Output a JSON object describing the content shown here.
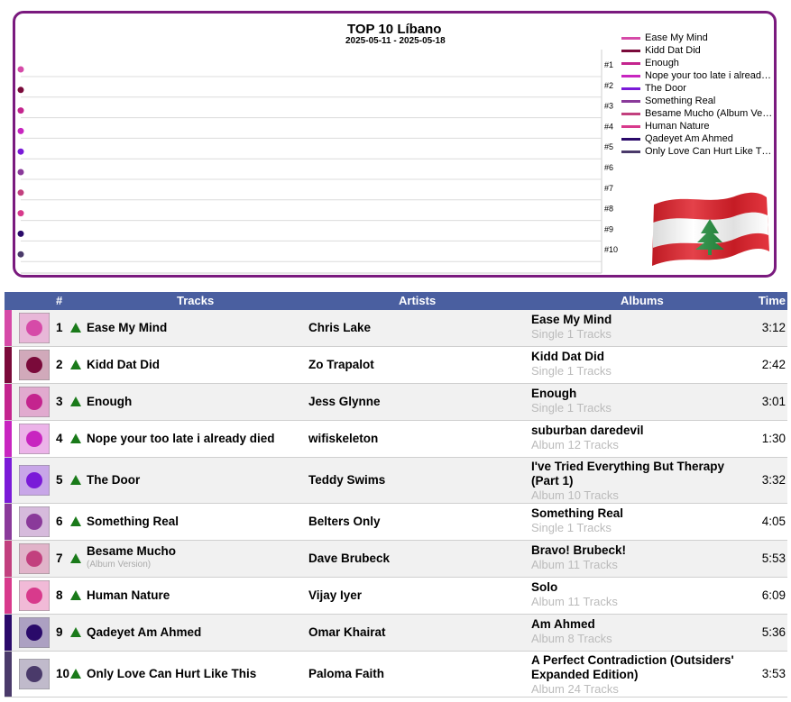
{
  "chart": {
    "title": "TOP 10 Líbano",
    "subtitle": "2025-05-11 - 2025-05-18",
    "rank_labels": [
      "#1",
      "#2",
      "#3",
      "#4",
      "#5",
      "#6",
      "#7",
      "#8",
      "#9",
      "#10"
    ],
    "flag_icon": "lebanon-flag-icon"
  },
  "chart_data": {
    "type": "line",
    "title": "TOP 10 Líbano",
    "subtitle": "2025-05-11 - 2025-05-18",
    "y_axis": "rank",
    "ylim": [
      1,
      10
    ],
    "series": [
      {
        "name": "Ease My Mind",
        "rank": 1,
        "color": "#d64aa8"
      },
      {
        "name": "Kidd Dat Did",
        "rank": 2,
        "color": "#7a0a3a"
      },
      {
        "name": "Enough",
        "rank": 3,
        "color": "#c4248e"
      },
      {
        "name": "Nope your too late i alread…",
        "rank": 4,
        "color": "#c825c0"
      },
      {
        "name": "The Door",
        "rank": 5,
        "color": "#7a1ad8"
      },
      {
        "name": "Something Real",
        "rank": 6,
        "color": "#8a3a9a"
      },
      {
        "name": "Besame Mucho (Album Ve…",
        "rank": 7,
        "color": "#c2407e"
      },
      {
        "name": "Human Nature",
        "rank": 8,
        "color": "#d83a8c"
      },
      {
        "name": "Qadeyet Am Ahmed",
        "rank": 9,
        "color": "#2a0a6a"
      },
      {
        "name": "Only Love Can Hurt Like T…",
        "rank": 10,
        "color": "#4a3a6a"
      }
    ]
  },
  "table": {
    "headers": {
      "num": "#",
      "tracks": "Tracks",
      "artists": "Artists",
      "albums": "Albums",
      "time": "Time"
    },
    "rows": [
      {
        "rank": "1",
        "track": "Ease My Mind",
        "track_sub": "",
        "artist": "Chris Lake",
        "album": "Ease My Mind",
        "album_sub": "Single 1 Tracks",
        "time": "3:12",
        "color": "#d64aa8",
        "thumb": "cover-ease-my-mind"
      },
      {
        "rank": "2",
        "track": "Kidd Dat Did",
        "track_sub": "",
        "artist": "Zo Trapalot",
        "album": "Kidd Dat Did",
        "album_sub": "Single 1 Tracks",
        "time": "2:42",
        "color": "#7a0a3a",
        "thumb": "cover-kidd-dat-did"
      },
      {
        "rank": "3",
        "track": "Enough",
        "track_sub": "",
        "artist": "Jess Glynne",
        "album": "Enough",
        "album_sub": "Single 1 Tracks",
        "time": "3:01",
        "color": "#c4248e",
        "thumb": "cover-enough"
      },
      {
        "rank": "4",
        "track": "Nope your too late i already died",
        "track_sub": "",
        "artist": "wifiskeleton",
        "album": "suburban daredevil",
        "album_sub": "Album 12 Tracks",
        "time": "1:30",
        "color": "#c825c0",
        "thumb": "cover-suburban-daredevil"
      },
      {
        "rank": "5",
        "track": "The Door",
        "track_sub": "",
        "artist": "Teddy Swims",
        "album": "I've Tried Everything But Therapy (Part 1)",
        "album_sub": "Album 10 Tracks",
        "time": "3:32",
        "color": "#7a1ad8",
        "thumb": "cover-the-door"
      },
      {
        "rank": "6",
        "track": "Something Real",
        "track_sub": "",
        "artist": "Belters Only",
        "album": "Something Real",
        "album_sub": "Single 1 Tracks",
        "time": "4:05",
        "color": "#8a3a9a",
        "thumb": "cover-something-real"
      },
      {
        "rank": "7",
        "track": "Besame Mucho",
        "track_sub": "(Album Version)",
        "artist": "Dave Brubeck",
        "album": "Bravo! Brubeck!",
        "album_sub": "Album 11 Tracks",
        "time": "5:53",
        "color": "#c2407e",
        "thumb": "cover-bravo-brubeck"
      },
      {
        "rank": "8",
        "track": "Human Nature",
        "track_sub": "",
        "artist": "Vijay Iyer",
        "album": "Solo",
        "album_sub": "Album 11 Tracks",
        "time": "6:09",
        "color": "#d83a8c",
        "thumb": "cover-solo"
      },
      {
        "rank": "9",
        "track": "Qadeyet Am Ahmed",
        "track_sub": "",
        "artist": "Omar Khairat",
        "album": "Am Ahmed",
        "album_sub": "Album 8 Tracks",
        "time": "5:36",
        "color": "#2a0a6a",
        "thumb": "cover-am-ahmed"
      },
      {
        "rank": "10",
        "track": "Only Love Can Hurt Like This",
        "track_sub": "",
        "artist": "Paloma Faith",
        "album": "A Perfect Contradiction (Outsiders' Expanded Edition)",
        "album_sub": "Album 24 Tracks",
        "time": "3:53",
        "color": "#4a3a6a",
        "thumb": "cover-perfect-contradiction"
      }
    ]
  }
}
